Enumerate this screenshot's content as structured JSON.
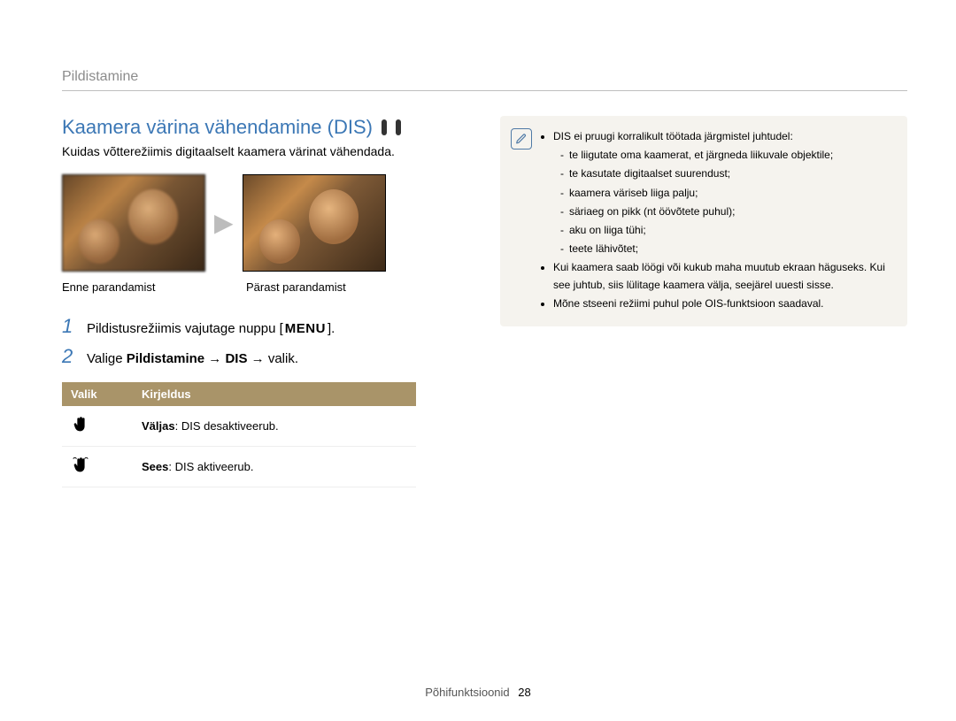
{
  "breadcrumb": "Pildistamine",
  "section": {
    "title": "Kaamera värina vähendamine (DIS)",
    "mode_icons": [
      "camera-p-icon",
      "scene-icon"
    ],
    "intro": "Kuidas võtterežiimis digitaalselt kaamera värinat vähendada."
  },
  "images": {
    "before_caption": "Enne parandamist",
    "after_caption": "Pärast parandamist"
  },
  "steps": [
    {
      "num": "1",
      "text_prefix": "Pildistusrežiimis vajutage nuppu [",
      "menu": "MENU",
      "text_suffix": "]."
    },
    {
      "num": "2",
      "text_prefix": "Valige ",
      "bold1": "Pildistamine",
      "arrow1": " → ",
      "bold2": "DIS",
      "arrow2": " → ",
      "text_suffix": "valik."
    }
  ],
  "table": {
    "header_option": "Valik",
    "header_desc": "Kirjeldus",
    "rows": [
      {
        "label": "Väljas",
        "desc": ": DIS desaktiveerub."
      },
      {
        "label": "Sees",
        "desc": ": DIS aktiveerub."
      }
    ]
  },
  "note": {
    "items": [
      {
        "text": "DIS ei pruugi korralikult töötada järgmistel juhtudel:",
        "sub": [
          "te liigutate oma kaamerat, et järgneda liikuvale objektile;",
          "te kasutate digitaalset suurendust;",
          "kaamera väriseb liiga palju;",
          "säriaeg on pikk (nt öövõtete puhul);",
          "aku on liiga tühi;",
          "teete lähivõtet;"
        ]
      },
      {
        "text": "Kui kaamera saab löögi või kukub maha muutub ekraan häguseks. Kui see juhtub, siis lülitage kaamera välja, seejärel uuesti sisse."
      },
      {
        "text": "Mõne stseeni režiimi puhul pole OIS-funktsioon saadaval."
      }
    ]
  },
  "footer": {
    "section": "Põhifunktsioonid",
    "page": "28"
  }
}
